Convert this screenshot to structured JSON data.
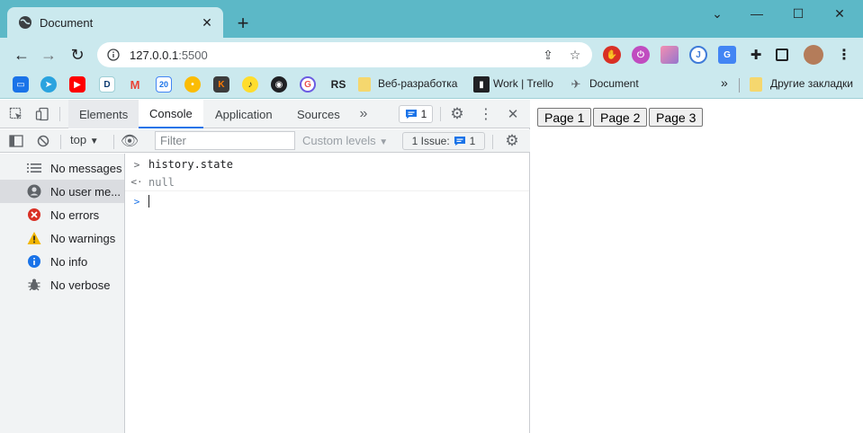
{
  "browser": {
    "tab_title": "Document",
    "url_host": "127.0.0.1",
    "url_port": ":5500",
    "colors": {
      "frame": "#5cb8c7",
      "toolbar": "#cbe9ee"
    }
  },
  "bookmarks": {
    "items": [
      {
        "icon": "chat-icon",
        "label": ""
      },
      {
        "icon": "telegram-icon",
        "label": ""
      },
      {
        "icon": "youtube-icon",
        "label": ""
      },
      {
        "icon": "d-icon",
        "label": ""
      },
      {
        "icon": "gmail-icon",
        "label": ""
      },
      {
        "icon": "calendar-icon",
        "label": ""
      },
      {
        "icon": "keep-icon",
        "label": ""
      },
      {
        "icon": "k-icon",
        "label": ""
      },
      {
        "icon": "music-icon",
        "label": ""
      },
      {
        "icon": "github-icon",
        "label": ""
      },
      {
        "icon": "g-icon",
        "label": ""
      },
      {
        "icon": "rs-icon",
        "label": ""
      }
    ],
    "folder_webdev": "Веб-разработка",
    "trello": "Work | Trello",
    "document": "Document",
    "other": "Другие закладки",
    "overflow": "»"
  },
  "devtools": {
    "tabs": [
      "Elements",
      "Console",
      "Application",
      "Sources"
    ],
    "messages_count": "1",
    "context": "top",
    "filter_placeholder": "Filter",
    "levels_label": "Custom levels",
    "issues_label": "1 Issue:",
    "issues_count": "1",
    "sidebar": [
      {
        "label": "No messages",
        "icon": "list-icon"
      },
      {
        "label": "No user me...",
        "icon": "user-icon"
      },
      {
        "label": "No errors",
        "icon": "error-icon"
      },
      {
        "label": "No warnings",
        "icon": "warning-icon"
      },
      {
        "label": "No info",
        "icon": "info-icon"
      },
      {
        "label": "No verbose",
        "icon": "bug-icon"
      }
    ],
    "console": {
      "input": "history.state",
      "result": "null"
    }
  },
  "page": {
    "buttons": [
      "Page 1",
      "Page 2",
      "Page 3"
    ]
  }
}
